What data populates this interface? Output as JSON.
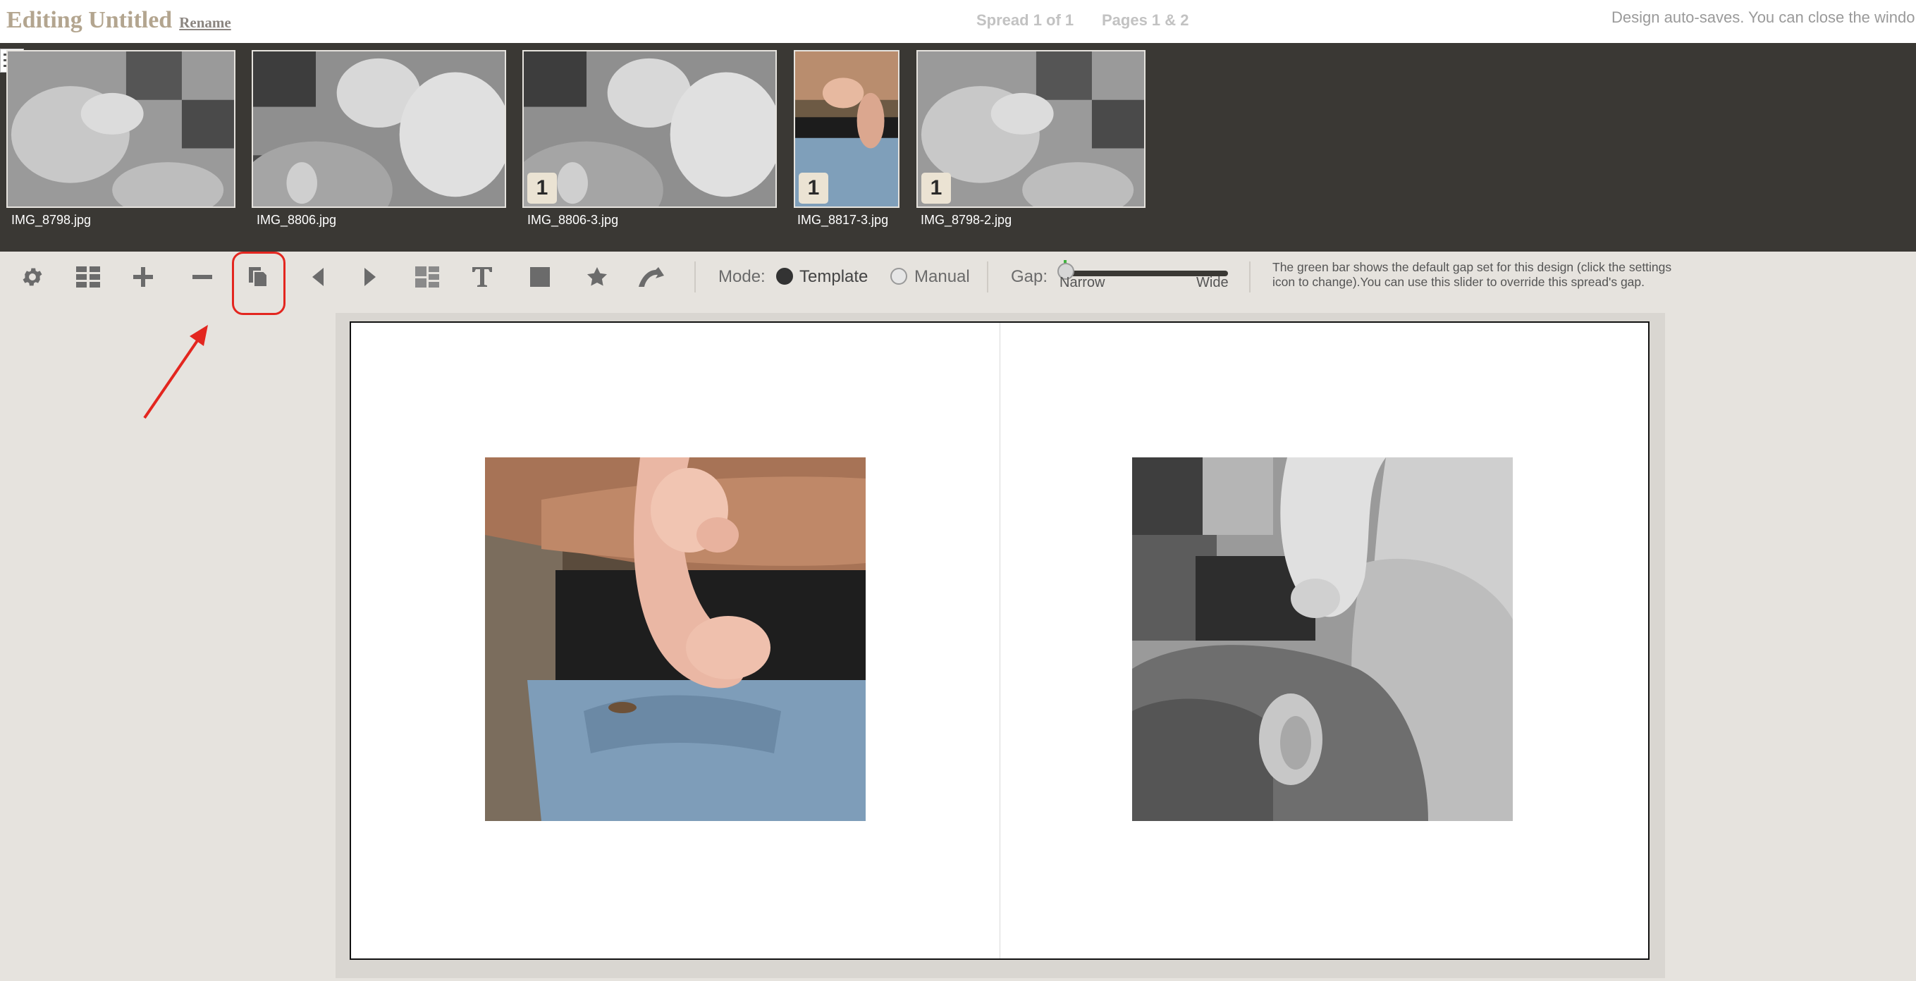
{
  "header": {
    "title": "Editing Untitled",
    "rename": "Rename",
    "spread_info": "Spread 1 of 1",
    "pages_info": "Pages 1 & 2",
    "autosave": "Design auto-saves. You can close the windo"
  },
  "filmstrip": {
    "menu_icon": "hamburger-icon",
    "thumbnails": [
      {
        "filename": "IMG_8798.jpg",
        "badge": ""
      },
      {
        "filename": "IMG_8806.jpg",
        "badge": ""
      },
      {
        "filename": "IMG_8806-3.jpg",
        "badge": "1"
      },
      {
        "filename": "IMG_8817-3.jpg",
        "badge": "1"
      },
      {
        "filename": "IMG_8798-2.jpg",
        "badge": "1"
      }
    ]
  },
  "toolbar": {
    "icons": [
      "gear-icon",
      "grid-icon",
      "plus-icon",
      "minus-icon",
      "duplicate-pages-icon",
      "arrow-left-icon",
      "arrow-right-icon",
      "layout-icon",
      "text-icon",
      "square-icon",
      "star-icon",
      "curl-icon"
    ],
    "mode_label": "Mode:",
    "mode_template": "Template",
    "mode_manual": "Manual",
    "mode_selected": "Template",
    "gap_label": "Gap:",
    "gap_narrow": "Narrow",
    "gap_wide": "Wide",
    "gap_value": 0,
    "gap_help": "The green bar shows the default gap set for this design (click the settings icon to change).You can use this slider to override this spread's gap."
  },
  "colors": {
    "title": "#b3a58f",
    "filmstrip_bg": "#3a3834",
    "highlight": "#e3261f",
    "default_gap": "#3fb33f"
  }
}
